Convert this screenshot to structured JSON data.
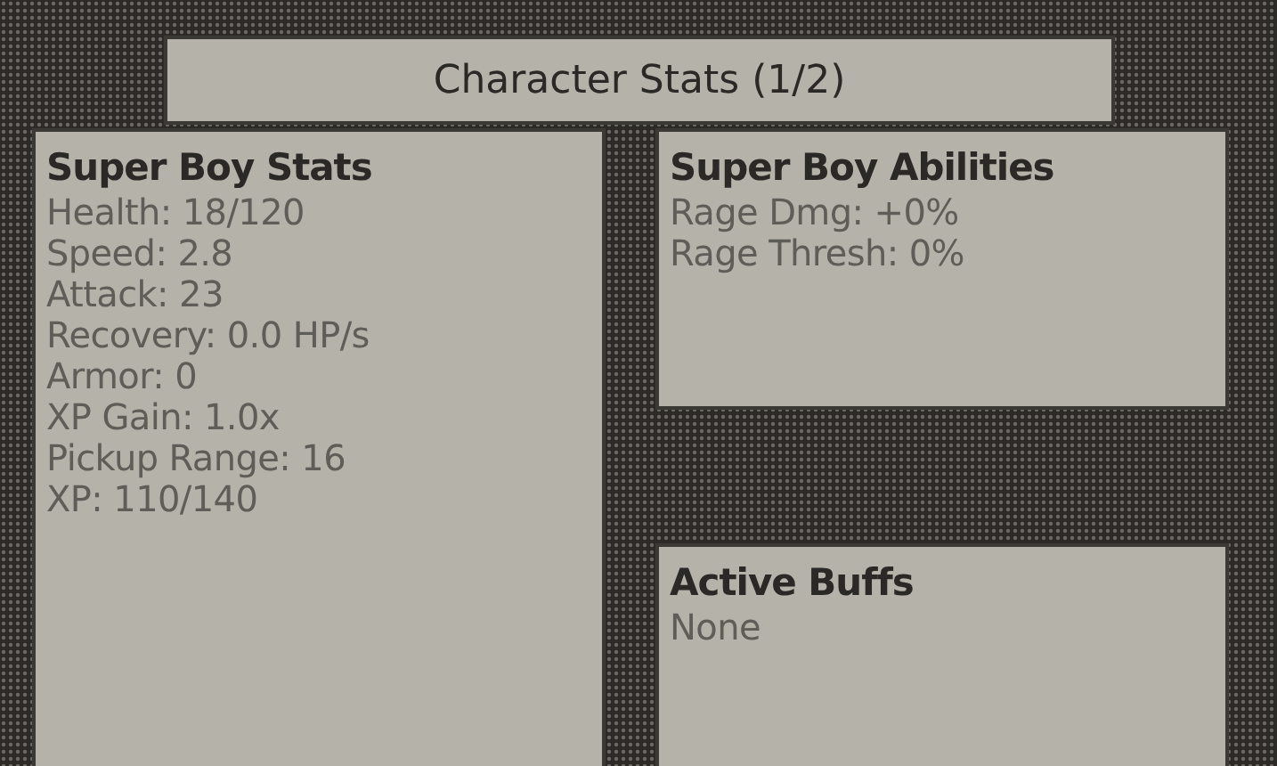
{
  "title": "Character Stats (1/2)",
  "panels": [
    {
      "heading": "Super Boy Stats",
      "lines": [
        "Health: 18/120",
        "Speed: 2.8",
        "Attack: 23",
        "Recovery: 0.0 HP/s",
        "Armor: 0",
        "XP Gain: 1.0x",
        "Pickup Range: 16",
        "XP: 110/140"
      ]
    },
    {
      "heading": "Super Boy Abilities",
      "lines": [
        "Rage Dmg: +0%",
        "Rage Thresh: 0%"
      ]
    },
    {
      "heading": "Active Buffs",
      "lines": [
        "None"
      ]
    }
  ]
}
